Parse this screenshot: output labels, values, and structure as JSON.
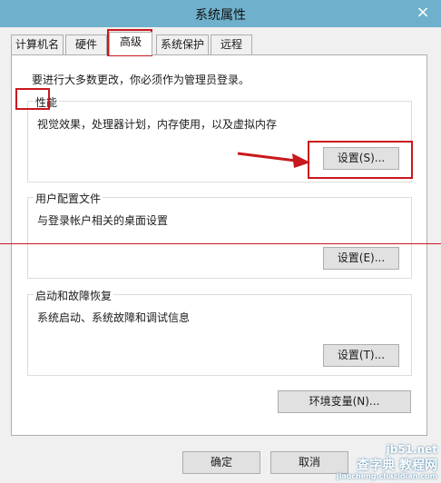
{
  "window": {
    "title": "系统属性",
    "close_glyph": "×"
  },
  "tabs": [
    {
      "label": "计算机名"
    },
    {
      "label": "硬件"
    },
    {
      "label": "高级"
    },
    {
      "label": "系统保护"
    },
    {
      "label": "远程"
    }
  ],
  "admin_note": "要进行大多数更改，你必须作为管理员登录。",
  "performance": {
    "title": "性能",
    "desc": "视觉效果，处理器计划，内存使用，以及虚拟内存",
    "button": "设置(S)..."
  },
  "user_profiles": {
    "title": "用户配置文件",
    "desc": "与登录帐户相关的桌面设置",
    "button": "设置(E)..."
  },
  "startup": {
    "title": "启动和故障恢复",
    "desc": "系统启动、系统故障和调试信息",
    "button": "设置(T)..."
  },
  "env_button": "环境变量(N)...",
  "footer": {
    "ok": "确定",
    "cancel": "取消"
  },
  "watermark": {
    "line1": "jb51.net",
    "line2": "查字典 教程网",
    "line3": "jiaocheng.chazidian.com"
  },
  "colors": {
    "highlight_red": "#c8181e",
    "titlebar": "#6fb0cc"
  }
}
